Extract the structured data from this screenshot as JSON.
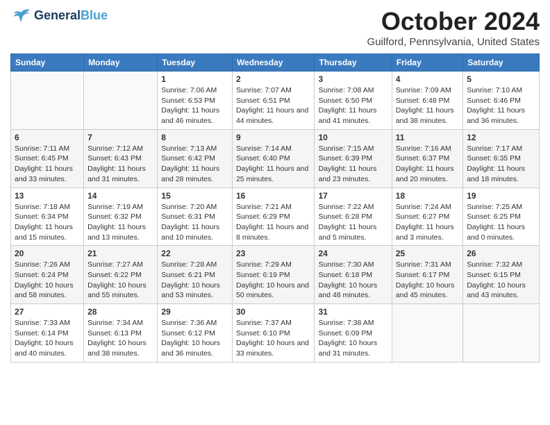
{
  "header": {
    "logo_line1": "General",
    "logo_line2": "Blue",
    "month": "October 2024",
    "location": "Guilford, Pennsylvania, United States"
  },
  "days_of_week": [
    "Sunday",
    "Monday",
    "Tuesday",
    "Wednesday",
    "Thursday",
    "Friday",
    "Saturday"
  ],
  "weeks": [
    [
      {
        "day": "",
        "info": ""
      },
      {
        "day": "",
        "info": ""
      },
      {
        "day": "1",
        "sunrise": "7:06 AM",
        "sunset": "6:53 PM",
        "daylight": "11 hours and 46 minutes."
      },
      {
        "day": "2",
        "sunrise": "7:07 AM",
        "sunset": "6:51 PM",
        "daylight": "11 hours and 44 minutes."
      },
      {
        "day": "3",
        "sunrise": "7:08 AM",
        "sunset": "6:50 PM",
        "daylight": "11 hours and 41 minutes."
      },
      {
        "day": "4",
        "sunrise": "7:09 AM",
        "sunset": "6:48 PM",
        "daylight": "11 hours and 38 minutes."
      },
      {
        "day": "5",
        "sunrise": "7:10 AM",
        "sunset": "6:46 PM",
        "daylight": "11 hours and 36 minutes."
      }
    ],
    [
      {
        "day": "6",
        "sunrise": "7:11 AM",
        "sunset": "6:45 PM",
        "daylight": "11 hours and 33 minutes."
      },
      {
        "day": "7",
        "sunrise": "7:12 AM",
        "sunset": "6:43 PM",
        "daylight": "11 hours and 31 minutes."
      },
      {
        "day": "8",
        "sunrise": "7:13 AM",
        "sunset": "6:42 PM",
        "daylight": "11 hours and 28 minutes."
      },
      {
        "day": "9",
        "sunrise": "7:14 AM",
        "sunset": "6:40 PM",
        "daylight": "11 hours and 25 minutes."
      },
      {
        "day": "10",
        "sunrise": "7:15 AM",
        "sunset": "6:39 PM",
        "daylight": "11 hours and 23 minutes."
      },
      {
        "day": "11",
        "sunrise": "7:16 AM",
        "sunset": "6:37 PM",
        "daylight": "11 hours and 20 minutes."
      },
      {
        "day": "12",
        "sunrise": "7:17 AM",
        "sunset": "6:35 PM",
        "daylight": "11 hours and 18 minutes."
      }
    ],
    [
      {
        "day": "13",
        "sunrise": "7:18 AM",
        "sunset": "6:34 PM",
        "daylight": "11 hours and 15 minutes."
      },
      {
        "day": "14",
        "sunrise": "7:19 AM",
        "sunset": "6:32 PM",
        "daylight": "11 hours and 13 minutes."
      },
      {
        "day": "15",
        "sunrise": "7:20 AM",
        "sunset": "6:31 PM",
        "daylight": "11 hours and 10 minutes."
      },
      {
        "day": "16",
        "sunrise": "7:21 AM",
        "sunset": "6:29 PM",
        "daylight": "11 hours and 8 minutes."
      },
      {
        "day": "17",
        "sunrise": "7:22 AM",
        "sunset": "6:28 PM",
        "daylight": "11 hours and 5 minutes."
      },
      {
        "day": "18",
        "sunrise": "7:24 AM",
        "sunset": "6:27 PM",
        "daylight": "11 hours and 3 minutes."
      },
      {
        "day": "19",
        "sunrise": "7:25 AM",
        "sunset": "6:25 PM",
        "daylight": "11 hours and 0 minutes."
      }
    ],
    [
      {
        "day": "20",
        "sunrise": "7:26 AM",
        "sunset": "6:24 PM",
        "daylight": "10 hours and 58 minutes."
      },
      {
        "day": "21",
        "sunrise": "7:27 AM",
        "sunset": "6:22 PM",
        "daylight": "10 hours and 55 minutes."
      },
      {
        "day": "22",
        "sunrise": "7:28 AM",
        "sunset": "6:21 PM",
        "daylight": "10 hours and 53 minutes."
      },
      {
        "day": "23",
        "sunrise": "7:29 AM",
        "sunset": "6:19 PM",
        "daylight": "10 hours and 50 minutes."
      },
      {
        "day": "24",
        "sunrise": "7:30 AM",
        "sunset": "6:18 PM",
        "daylight": "10 hours and 48 minutes."
      },
      {
        "day": "25",
        "sunrise": "7:31 AM",
        "sunset": "6:17 PM",
        "daylight": "10 hours and 45 minutes."
      },
      {
        "day": "26",
        "sunrise": "7:32 AM",
        "sunset": "6:15 PM",
        "daylight": "10 hours and 43 minutes."
      }
    ],
    [
      {
        "day": "27",
        "sunrise": "7:33 AM",
        "sunset": "6:14 PM",
        "daylight": "10 hours and 40 minutes."
      },
      {
        "day": "28",
        "sunrise": "7:34 AM",
        "sunset": "6:13 PM",
        "daylight": "10 hours and 38 minutes."
      },
      {
        "day": "29",
        "sunrise": "7:36 AM",
        "sunset": "6:12 PM",
        "daylight": "10 hours and 36 minutes."
      },
      {
        "day": "30",
        "sunrise": "7:37 AM",
        "sunset": "6:10 PM",
        "daylight": "10 hours and 33 minutes."
      },
      {
        "day": "31",
        "sunrise": "7:38 AM",
        "sunset": "6:09 PM",
        "daylight": "10 hours and 31 minutes."
      },
      {
        "day": "",
        "info": ""
      },
      {
        "day": "",
        "info": ""
      }
    ]
  ]
}
